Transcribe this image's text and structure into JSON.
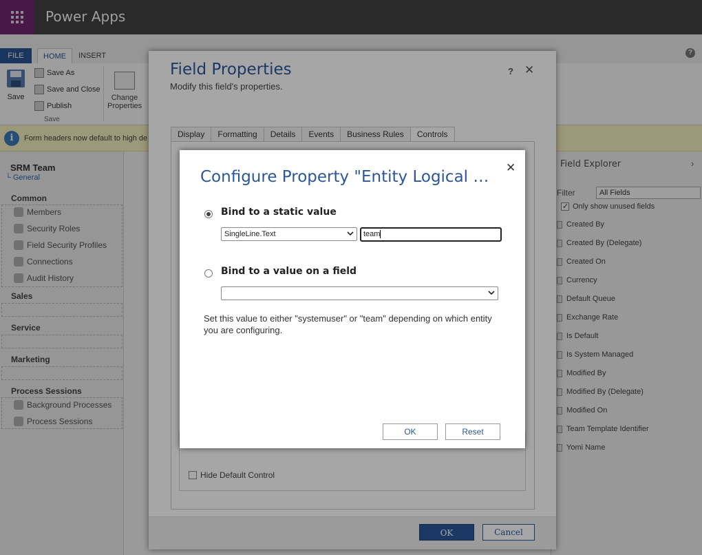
{
  "app": {
    "title": "Power Apps"
  },
  "ribbon": {
    "tabs": {
      "file": "FILE",
      "home": "HOME",
      "insert": "INSERT"
    },
    "save": "Save",
    "save_as": "Save As",
    "save_and_close": "Save and Close",
    "publish": "Publish",
    "group_label": "Save",
    "change_properties_line1": "Change",
    "change_properties_line2": "Properties"
  },
  "infobar": {
    "text": "Form headers now default to high de"
  },
  "leftnav": {
    "entity": "SRM Team",
    "form": "General",
    "sections": [
      {
        "label": "Common",
        "items": [
          "Members",
          "Security Roles",
          "Field Security Profiles",
          "Connections",
          "Audit History"
        ]
      },
      {
        "label": "Sales",
        "items": []
      },
      {
        "label": "Service",
        "items": []
      },
      {
        "label": "Marketing",
        "items": []
      },
      {
        "label": "Process Sessions",
        "items": [
          "Background Processes",
          "Process Sessions"
        ]
      }
    ]
  },
  "field_explorer": {
    "title": "Field Explorer",
    "filter_label": "Filter",
    "filter_value": "All Fields",
    "only_unused": "Only show unused fields",
    "fields": [
      "Created By",
      "Created By (Delegate)",
      "Created On",
      "Currency",
      "Default Queue",
      "Exchange Rate",
      "Is Default",
      "Is System Managed",
      "Modified By",
      "Modified By (Delegate)",
      "Modified On",
      "Team Template Identifier",
      "Yomi Name"
    ]
  },
  "field_properties": {
    "title": "Field Properties",
    "subtitle": "Modify this field's properties.",
    "help": "?",
    "close": "✕",
    "tabs": [
      "Display",
      "Formatting",
      "Details",
      "Events",
      "Business Rules",
      "Controls"
    ],
    "hide_default_control": "Hide Default Control",
    "ok": "OK",
    "cancel": "Cancel"
  },
  "configure_property": {
    "title": "Configure Property \"Entity Logical …",
    "close": "✕",
    "option_static": "Bind to a static value",
    "type_select": "SingleLine.Text",
    "static_value": "team",
    "option_field": "Bind to a value on a field",
    "field_select": "",
    "note": "Set this value to either \"systemuser\" or \"team\" depending on which entity you are configuring.",
    "ok": "OK",
    "reset": "Reset"
  },
  "colors": {
    "accent": "#2b579a",
    "brand": "#742774",
    "topbar": "#444444",
    "info": "#fcf5c6"
  }
}
